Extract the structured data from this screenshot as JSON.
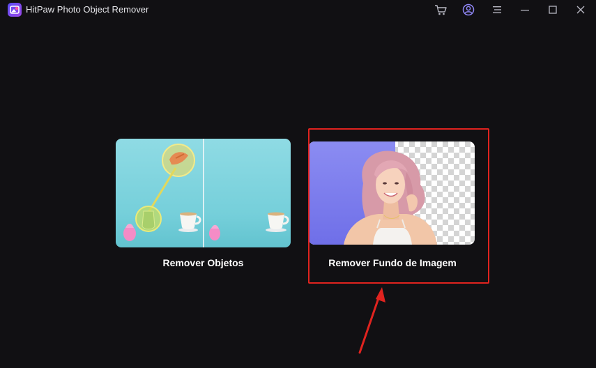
{
  "window": {
    "title": "HitPaw Photo Object Remover",
    "icons": [
      "cart-icon",
      "user-account-icon",
      "menu-icon",
      "minimize-icon",
      "maximize-icon",
      "close-icon"
    ]
  },
  "options": [
    {
      "id": "remove-objects",
      "label": "Remover Objetos"
    },
    {
      "id": "remove-background",
      "label": "Remover Fundo de Imagem"
    }
  ],
  "colors": {
    "background": "#111013",
    "highlight": "#e0231f",
    "remove_objects_bg": "#7cd3de",
    "remove_bg_purple": "#7f7ff0"
  }
}
